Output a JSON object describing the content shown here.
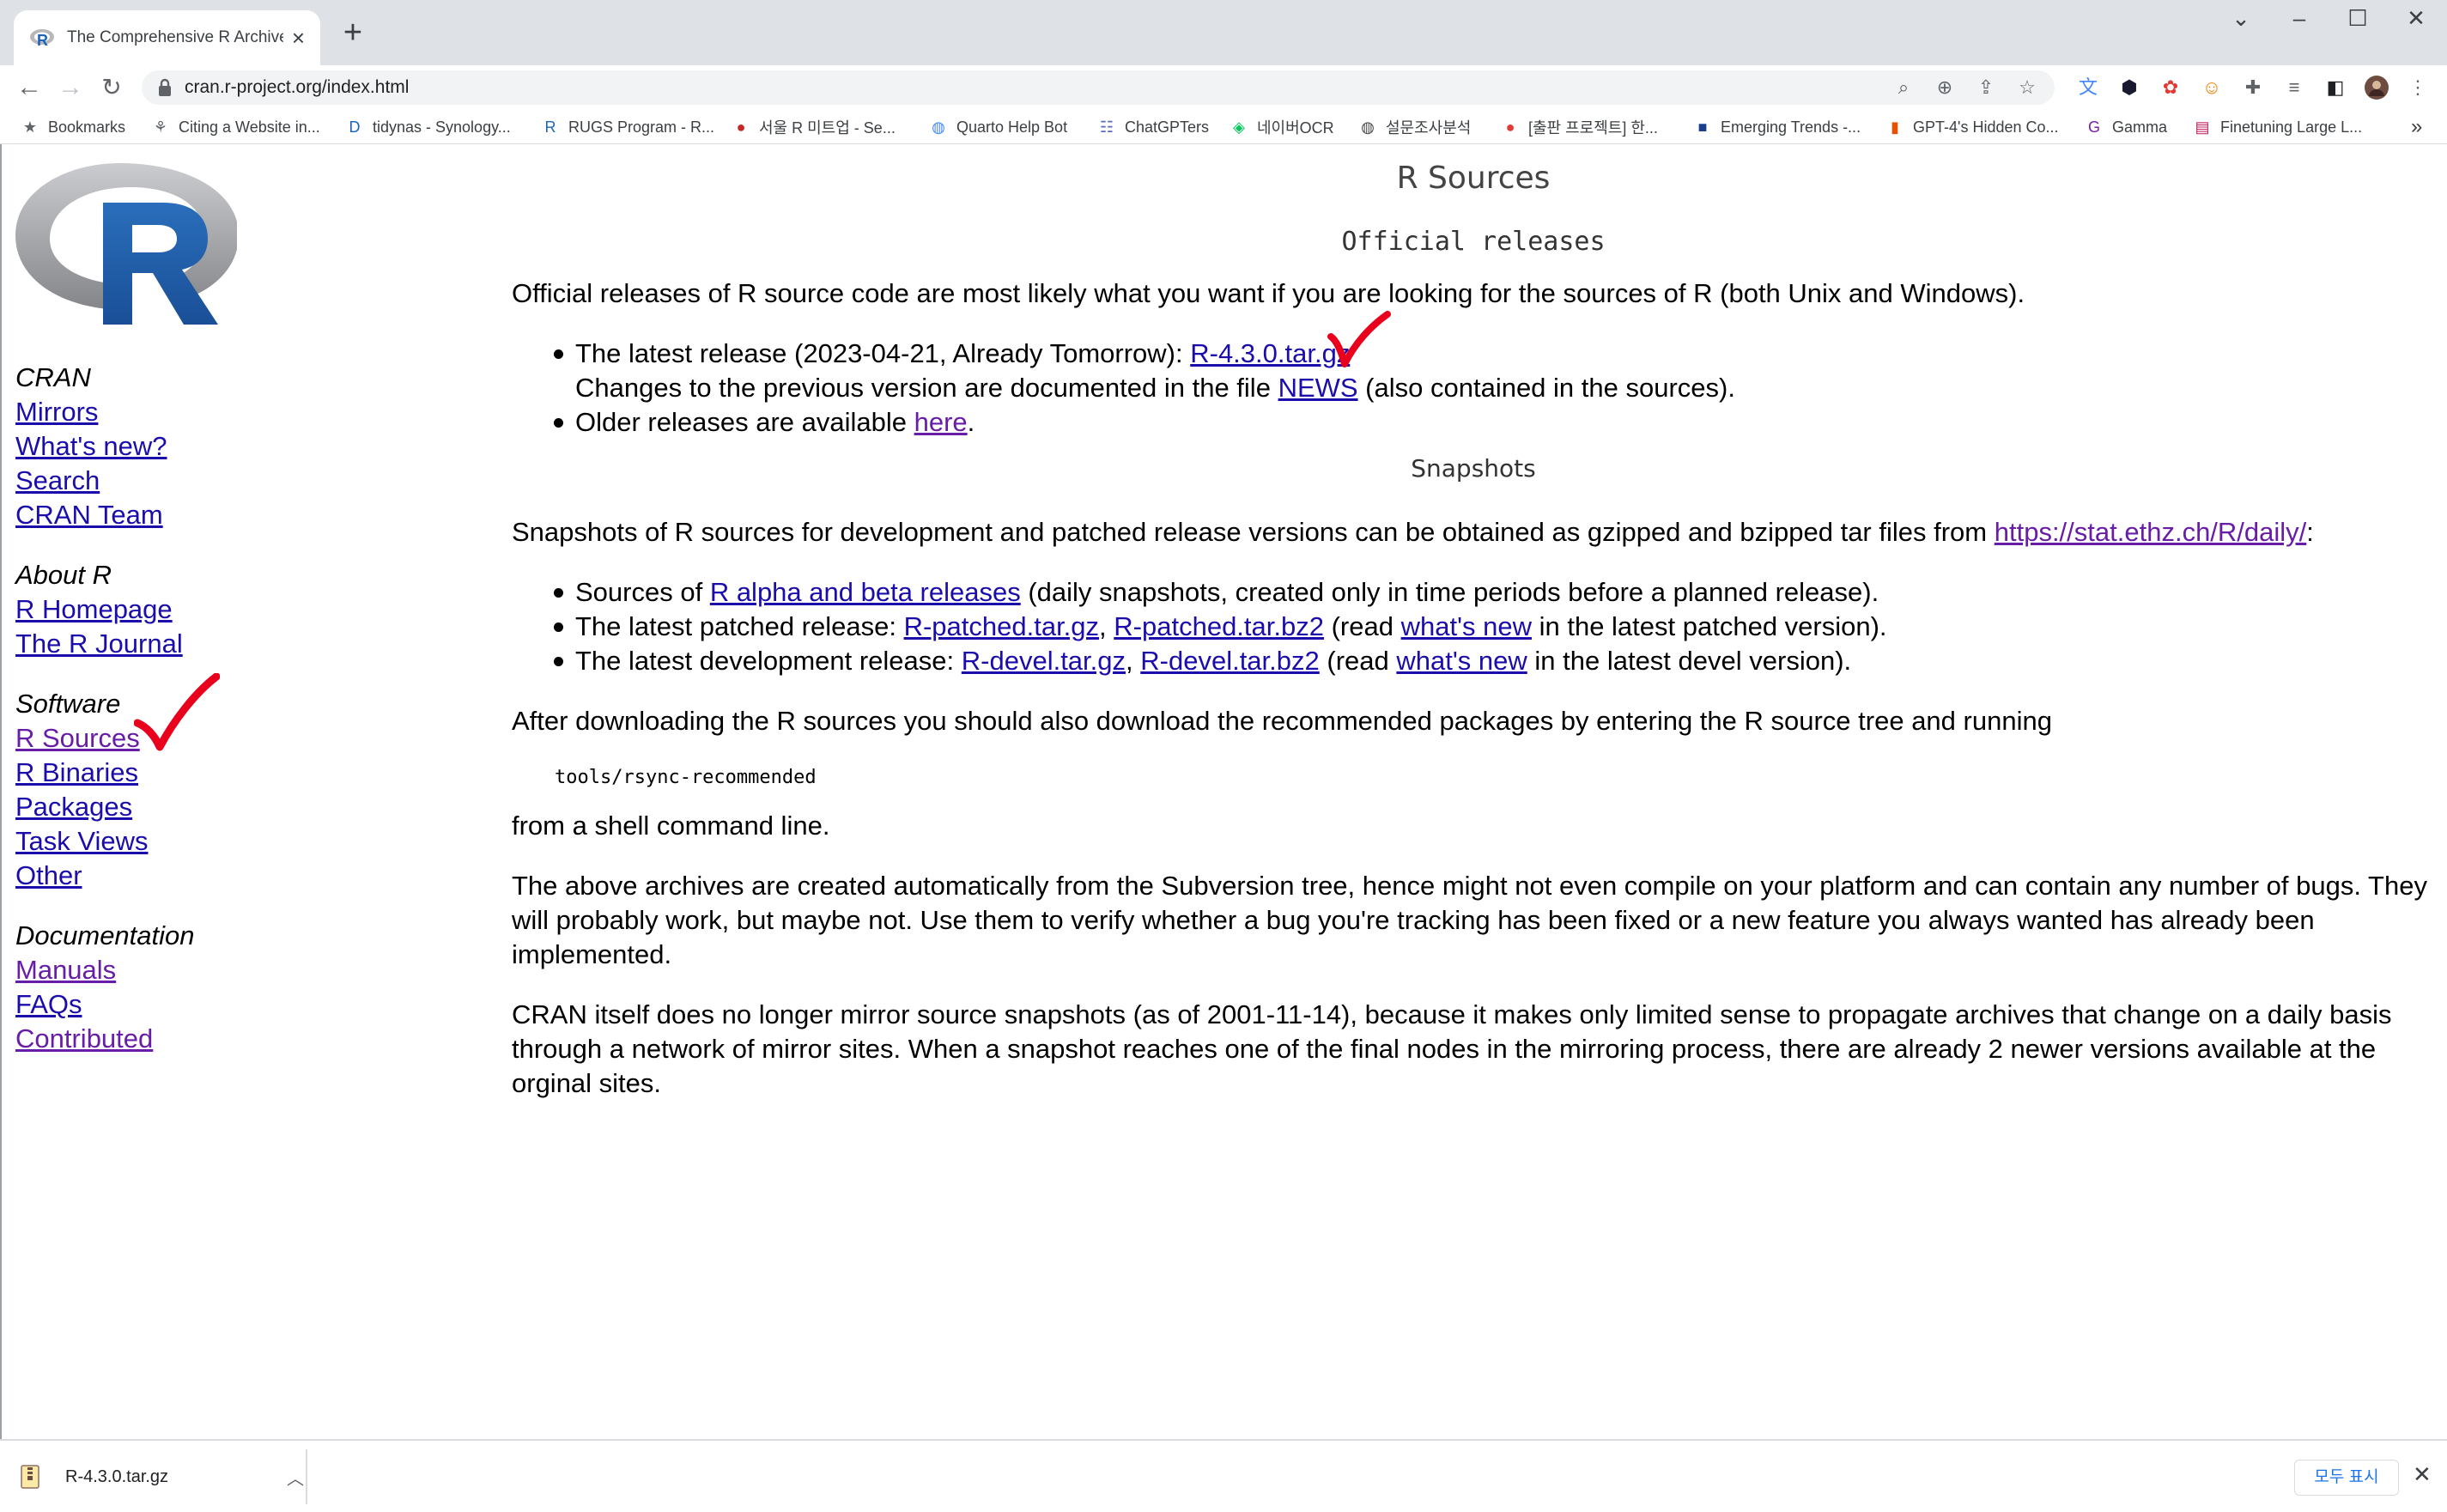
{
  "browser": {
    "tab_title": "The Comprehensive R Archive N",
    "url": "cran.r-project.org/index.html",
    "bookmarks": [
      {
        "label": "Bookmarks",
        "icon": "star-icon"
      },
      {
        "label": "Citing a Website in...",
        "icon": "leaf-icon"
      },
      {
        "label": "tidynas - Synology...",
        "icon": "dsm-icon"
      },
      {
        "label": "RUGS Program - R...",
        "icon": "r-icon"
      },
      {
        "label": "서울 R 미트업 - Se...",
        "icon": "meetup-icon"
      },
      {
        "label": "Quarto Help Bot",
        "icon": "globe-icon"
      },
      {
        "label": "ChatGPTers",
        "icon": "chat-icon"
      },
      {
        "label": "네이버OCR",
        "icon": "ocr-icon"
      },
      {
        "label": "설문조사분석",
        "icon": "globe-dark-icon"
      },
      {
        "label": "[출판 프로젝트] 한...",
        "icon": "publish-icon"
      },
      {
        "label": "Emerging Trends -...",
        "icon": "square-icon"
      },
      {
        "label": "GPT-4's Hidden Co...",
        "icon": "bookmark-icon"
      },
      {
        "label": "Gamma",
        "icon": "gamma-icon"
      },
      {
        "label": "Finetuning Large L...",
        "icon": "doc-icon"
      }
    ],
    "more_bookmarks": "»"
  },
  "sidebar": {
    "sections": [
      {
        "heading": "CRAN",
        "links": [
          {
            "label": "Mirrors",
            "visited": false
          },
          {
            "label": "What's new?",
            "visited": false
          },
          {
            "label": "Search",
            "visited": false
          },
          {
            "label": "CRAN Team",
            "visited": false
          }
        ]
      },
      {
        "heading": "About R",
        "links": [
          {
            "label": "R Homepage",
            "visited": false
          },
          {
            "label": "The R Journal",
            "visited": false
          }
        ]
      },
      {
        "heading": "Software",
        "links": [
          {
            "label": "R Sources",
            "visited": true
          },
          {
            "label": "R Binaries",
            "visited": false
          },
          {
            "label": "Packages",
            "visited": false
          },
          {
            "label": "Task Views",
            "visited": false
          },
          {
            "label": "Other",
            "visited": false
          }
        ]
      },
      {
        "heading": "Documentation",
        "links": [
          {
            "label": "Manuals",
            "visited": true
          },
          {
            "label": "FAQs",
            "visited": false
          },
          {
            "label": "Contributed",
            "visited": true
          }
        ]
      }
    ]
  },
  "content": {
    "title": "R Sources",
    "official_heading": "Official releases",
    "official_intro": "Official releases of R source code are most likely what you want if you are looking for the sources of R (both Unix and Windows).",
    "latest_prefix": "The latest release (2023-04-21, Already Tomorrow): ",
    "latest_link": "R-4.3.0.tar.gz",
    "changes_prefix": "Changes to the previous version are documented in the file ",
    "news_link": "NEWS",
    "changes_suffix": " (also contained in the sources).",
    "older_prefix": "Older releases are available ",
    "older_link": "here",
    "older_suffix": ".",
    "snapshots_heading": "Snapshots",
    "snapshots_intro": "Snapshots of R sources for development and patched release versions can be obtained as gzipped and bzipped tar files from ",
    "snapshots_link": "https://stat.ethz.ch/R/daily/",
    "snapshots_suffix": ":",
    "sources_prefix": "Sources of ",
    "alpha_beta_link": "R alpha and beta releases",
    "sources_suffix": " (daily snapshots, created only in time periods before a planned release).",
    "patched_prefix": "The latest patched release: ",
    "patched_gz": "R-patched.tar.gz",
    "comma": ", ",
    "patched_bz2": "R-patched.tar.bz2",
    "read_prefix": " (read ",
    "whats_new": "what's new",
    "patched_suffix": " in the latest patched version).",
    "devel_prefix": "The latest development release: ",
    "devel_gz": "R-devel.tar.gz",
    "devel_bz2": "R-devel.tar.bz2",
    "devel_suffix": " in the latest devel version).",
    "after_download": "After downloading the R sources you should also download the recommended packages by entering the R source tree and running",
    "command": "tools/rsync-recommended",
    "shell_line": "from a shell command line.",
    "archives_para": "The above archives are created automatically from the Subversion tree, hence might not even compile on your platform and can contain any number of bugs. They will probably work, but maybe not. Use them to verify whether a bug you're tracking has been fixed or a new feature you always wanted has already been implemented.",
    "mirror_para": "CRAN itself does no longer mirror source snapshots (as of 2001-11-14), because it makes only limited sense to propagate archives that change on a daily basis through a network of mirror sites. When a snapshot reaches one of the final nodes in the mirroring process, there are already 2 newer versions available at the orginal sites."
  },
  "download_bar": {
    "file_name": "R-4.3.0.tar.gz",
    "show_all": "모두 표시"
  },
  "colors": {
    "link": "#1a0dab",
    "visited": "#681da8",
    "annotation_check": "#e8001c"
  }
}
